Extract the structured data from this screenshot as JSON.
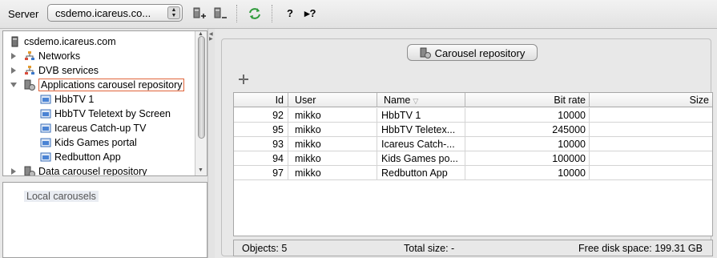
{
  "toolbar": {
    "server_label": "Server",
    "server_value": "csdemo.icareus.co...",
    "help_label": "?",
    "context_help_label": "▸?",
    "icons": [
      "server-add-icon",
      "server-remove-icon",
      "refresh-icon",
      "help-icon",
      "context-help-icon"
    ]
  },
  "tree": {
    "root": "csdemo.icareus.com",
    "items": [
      {
        "label": "Networks",
        "icon": "network-icon",
        "expanded": false
      },
      {
        "label": "DVB services",
        "icon": "network-icon",
        "expanded": false
      },
      {
        "label": "Applications carousel repository",
        "icon": "repository-icon",
        "expanded": true,
        "selected": true
      },
      {
        "label": "HbbTV 1",
        "icon": "carousel-icon"
      },
      {
        "label": "HbbTV Teletext by Screen",
        "icon": "carousel-icon"
      },
      {
        "label": "Icareus Catch-up TV",
        "icon": "carousel-icon"
      },
      {
        "label": "Kids Games portal",
        "icon": "carousel-icon"
      },
      {
        "label": "Redbutton App",
        "icon": "carousel-icon"
      },
      {
        "label": "Data carousel repository",
        "icon": "repository-icon",
        "expanded": false
      }
    ]
  },
  "local": {
    "label": "Local carousels"
  },
  "panel": {
    "title": "Carousel repository"
  },
  "table": {
    "columns": [
      "Id",
      "User",
      "Name",
      "Bit rate",
      "Size"
    ],
    "rows": [
      {
        "id": "92",
        "user": "mikko",
        "name": "HbbTV 1",
        "bitrate": "10000",
        "size": ""
      },
      {
        "id": "95",
        "user": "mikko",
        "name": "HbbTV Teletex...",
        "bitrate": "245000",
        "size": ""
      },
      {
        "id": "93",
        "user": "mikko",
        "name": "Icareus Catch-...",
        "bitrate": "10000",
        "size": ""
      },
      {
        "id": "94",
        "user": "mikko",
        "name": "Kids Games po...",
        "bitrate": "100000",
        "size": ""
      },
      {
        "id": "97",
        "user": "mikko",
        "name": "Redbutton App",
        "bitrate": "10000",
        "size": ""
      }
    ]
  },
  "status": {
    "objects": "Objects: 5",
    "total_size": "Total size: -",
    "free_disk": "Free disk space: 199.31 GB"
  },
  "colors": {
    "selection_border": "#e0643a",
    "accent_green": "#2e9a3a"
  }
}
